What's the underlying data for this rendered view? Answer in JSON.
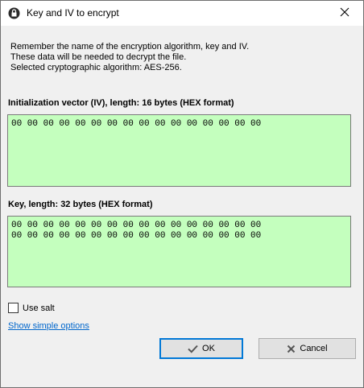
{
  "window": {
    "title": "Key and IV to encrypt"
  },
  "info": {
    "line1": "Remember the name of the encryption algorithm, key and IV.",
    "line2": "These data will be needed to decrypt the file.",
    "line3": "Selected cryptographic algorithm: AES-256."
  },
  "iv": {
    "label": "Initialization vector (IV), length: 16 bytes (HEX format)",
    "value": "00 00 00 00 00 00 00 00 00 00 00 00 00 00 00 00"
  },
  "key": {
    "label": "Key, length: 32 bytes (HEX format)",
    "value": "00 00 00 00 00 00 00 00 00 00 00 00 00 00 00 00\n00 00 00 00 00 00 00 00 00 00 00 00 00 00 00 00"
  },
  "options": {
    "use_salt_label": "Use salt",
    "use_salt_checked": false,
    "show_simple_label": "Show simple options"
  },
  "buttons": {
    "ok_label": "OK",
    "cancel_label": "Cancel"
  },
  "colors": {
    "hex_field_bg": "#c4ffbe",
    "link": "#0066cc",
    "default_button_border": "#0078d7"
  }
}
